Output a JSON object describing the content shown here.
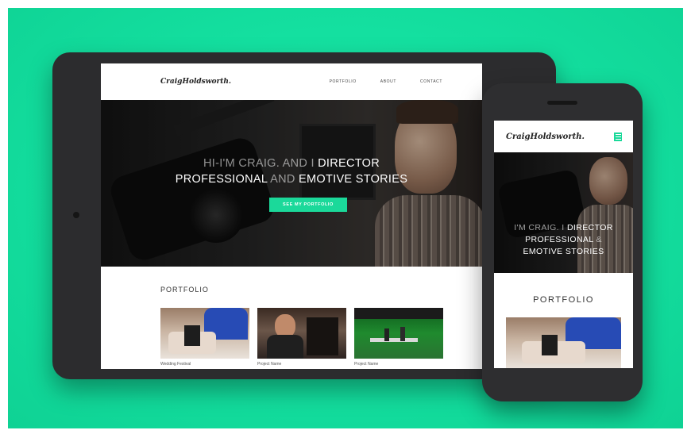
{
  "colors": {
    "background": "#14e0a0",
    "accent": "#1bd99a",
    "device": "#2c2c2e"
  },
  "tablet": {
    "logo": "CraigHoldsworth.",
    "nav": [
      "PORTFOLIO",
      "ABOUT",
      "CONTACT"
    ],
    "hero": {
      "line1_dim": "HI-I'M CRAIG. AND I ",
      "line1_bright": "DIRECTOR",
      "line2_bright_a": "PROFESSIONAL",
      "line2_dim": " AND ",
      "line2_bright_b": "EMOTIVE STORIES",
      "cta": "SEE MY PORTFOLIO"
    },
    "portfolio": {
      "title": "PORTFOLIO",
      "items": [
        {
          "caption": "Wedding Festival"
        },
        {
          "caption": "Project Name"
        },
        {
          "caption": "Project Name"
        }
      ]
    }
  },
  "phone": {
    "logo": "CraigHoldsworth.",
    "menu_icon": "hamburger-icon",
    "hero": {
      "line1_dim": "I'M CRAIG. I ",
      "line1_bright": "DIRECTOR",
      "line2_bright": "PROFESSIONAL",
      "line2_dim": " & ",
      "line3_bright": "EMOTIVE STORIES"
    },
    "portfolio_title": "PORTFOLIO"
  }
}
